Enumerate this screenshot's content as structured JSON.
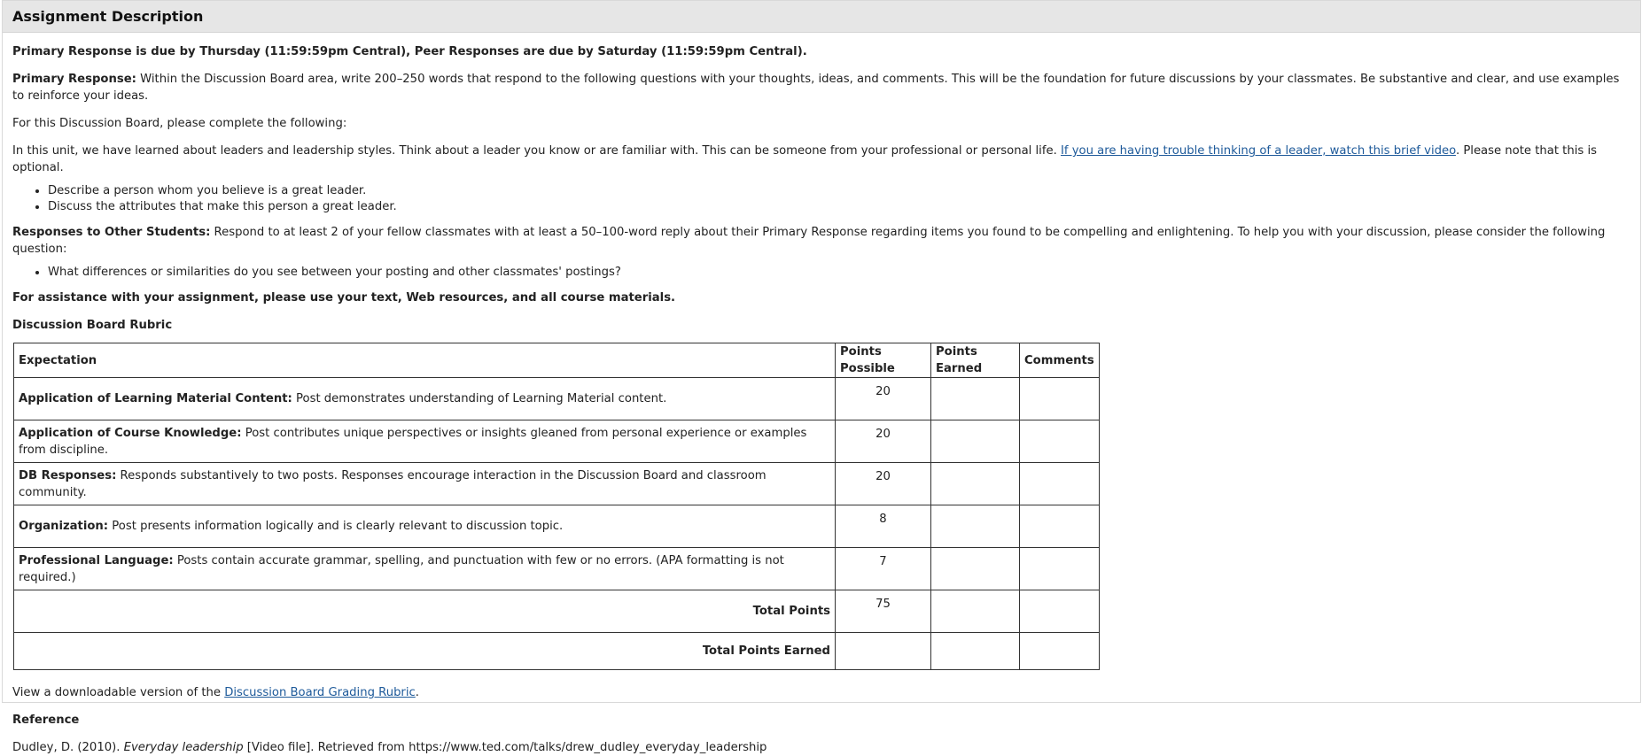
{
  "header": {
    "title": "Assignment Description"
  },
  "due_line": "Primary Response is due by Thursday (11:59:59pm Central), Peer Responses are due by Saturday (11:59:59pm Central).",
  "primary_response": {
    "label": "Primary Response:",
    "text": " Within the Discussion Board area, write 200–250 words that respond to the following questions with your thoughts, ideas, and comments. This will be the foundation for future discussions by your classmates. Be substantive and clear, and use examples to reinforce your ideas."
  },
  "complete_line": "For this Discussion Board, please complete the following:",
  "unit_paragraph": {
    "text_before": "In this unit, we have learned about leaders and leadership styles. Think about a leader you know or are familiar with. This can be someone from your professional or personal life. ",
    "link_text": "If you are having trouble thinking of a leader, watch this brief video",
    "text_after": ". Please note that this is optional."
  },
  "tasks": [
    "Describe a person whom you believe is a great leader.",
    "Discuss the attributes that make this person a great leader."
  ],
  "responses": {
    "label": "Responses to Other Students:",
    "text": " Respond to at least 2 of your fellow classmates with at least a 50–100-word reply about their Primary Response regarding items you found to be compelling and enlightening. To help you with your discussion, please consider the following question:"
  },
  "questions": [
    "What differences or similarities do you see between your posting and other classmates' postings?"
  ],
  "assistance": "For assistance with your assignment, please use your text, Web resources, and all course materials.",
  "rubric": {
    "title": "Discussion Board Rubric",
    "headers": [
      "Expectation",
      "Points Possible",
      "Points Earned",
      "Comments"
    ],
    "rows": [
      {
        "label": "Application of Learning Material Content:",
        "text": " Post demonstrates understanding of Learning Material content.",
        "points": "20"
      },
      {
        "label": "Application of Course Knowledge:",
        "text": " Post contributes unique perspectives or insights gleaned from personal experience or examples from discipline.",
        "points": "20"
      },
      {
        "label": "DB Responses:",
        "text": " Responds substantively to two posts. Responses encourage interaction in the Discussion Board and classroom community.",
        "points": "20"
      },
      {
        "label": "Organization:",
        "text": " Post presents information logically and is clearly relevant to discussion topic.",
        "points": "8"
      },
      {
        "label": "Professional Language:",
        "text": " Posts contain accurate grammar, spelling, and punctuation with few or no errors. (APA formatting is not required.)",
        "points": "7"
      }
    ],
    "total_label": "Total Points",
    "total_value": "75",
    "earned_label": "Total Points Earned"
  },
  "download": {
    "text_before": "View a downloadable version of the ",
    "link_text": "Discussion Board Grading Rubric",
    "text_after": "."
  },
  "reference": {
    "heading": "Reference",
    "author": "Dudley, D. (2010). ",
    "title": "Everyday leadership",
    "rest": " [Video file]. Retrieved from https://www.ted.com/talks/drew_dudley_everyday_leadership"
  },
  "colors": {
    "link": "#1e5a9a",
    "header_bg": "#e6e6e6",
    "border": "#333333"
  }
}
